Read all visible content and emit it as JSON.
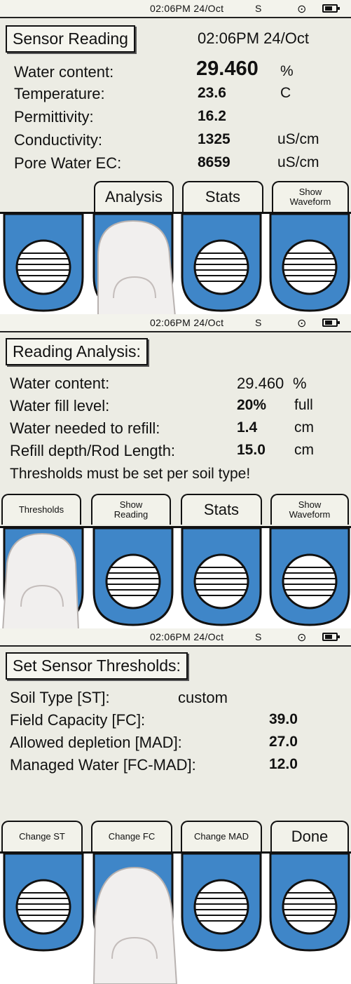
{
  "status": {
    "time": "02:06PM 24/Oct",
    "s": "S",
    "loc_icon": "target-icon",
    "battery_icon": "battery-icon"
  },
  "screen1": {
    "title": "Sensor Reading",
    "header_time": "02:06PM 24/Oct",
    "rows": [
      {
        "label": "Water content:",
        "value": "29.460",
        "unit": "%"
      },
      {
        "label": "Temperature:",
        "value": "23.6",
        "unit": "C"
      },
      {
        "label": "Permittivity:",
        "value": "16.2",
        "unit": ""
      },
      {
        "label": "Conductivity:",
        "value": "1325",
        "unit": "uS/cm"
      },
      {
        "label": "Pore Water EC:",
        "value": "8659",
        "unit": "uS/cm"
      }
    ],
    "softkeys": [
      "Analysis",
      "Stats",
      "Show",
      "Waveform"
    ]
  },
  "screen2": {
    "title": "Reading Analysis:",
    "rows": [
      {
        "label": "Water content:",
        "value": "29.460",
        "unit": "%"
      },
      {
        "label": "Water fill level:",
        "value": "20%",
        "unit": "full"
      },
      {
        "label": "Water needed to refill:",
        "value": "1.4",
        "unit": "cm"
      },
      {
        "label": "Refill depth/Rod Length:",
        "value": "15.0",
        "unit": "cm"
      }
    ],
    "note": "Thresholds must be set per soil type!",
    "softkeys": [
      "Thresholds",
      "Show",
      "Reading",
      "Stats",
      "Show",
      "Waveform"
    ]
  },
  "screen3": {
    "title": "Set Sensor Thresholds:",
    "soil_label": "Soil Type [ST]:",
    "soil_value": "custom",
    "rows": [
      {
        "label": "Field Capacity [FC]:",
        "value": "39.0"
      },
      {
        "label": "Allowed depletion [MAD]:",
        "value": "27.0"
      },
      {
        "label": "Managed Water [FC-MAD]:",
        "value": "12.0"
      }
    ],
    "softkeys": [
      "Change ST",
      "Change FC",
      "Change MAD",
      "Done"
    ]
  },
  "colors": {
    "button_blue": "#3f86c8",
    "screen_bg": "#ecece4"
  }
}
